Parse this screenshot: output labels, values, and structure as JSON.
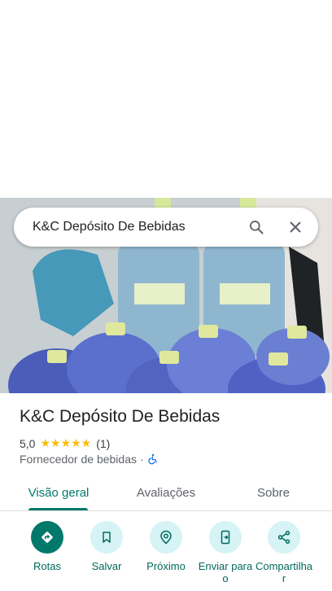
{
  "search": {
    "query": "K&C Depósito De Bebidas"
  },
  "place": {
    "name": "K&C Depósito De Bebidas",
    "rating": "5,0",
    "stars": "★★★★★",
    "review_count": "(1)",
    "category": "Fornecedor de bebidas",
    "separator": "·"
  },
  "tabs": [
    {
      "label": "Visão geral"
    },
    {
      "label": "Avaliações"
    },
    {
      "label": "Sobre"
    }
  ],
  "actions": [
    {
      "label": "Rotas",
      "icon": "directions-icon"
    },
    {
      "label": "Salvar",
      "icon": "bookmark-icon"
    },
    {
      "label": "Próximo",
      "icon": "nearby-icon"
    },
    {
      "label": "Enviar para o",
      "icon": "send-to-phone-icon"
    },
    {
      "label": "Compartilha r",
      "icon": "share-icon"
    }
  ],
  "colors": {
    "accent": "#00796b",
    "action_bg": "#d6f3f6",
    "star": "#fbbc04"
  }
}
